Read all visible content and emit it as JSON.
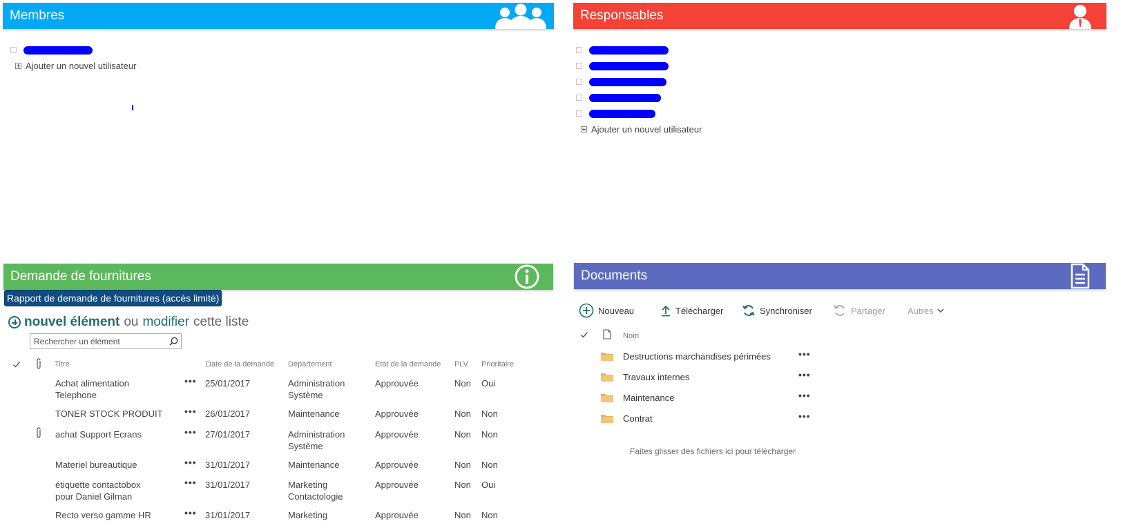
{
  "members": {
    "title": "Membres",
    "add_user_label": "Ajouter un nouvel utilisateur"
  },
  "responsables": {
    "title": "Responsables",
    "add_user_label": "Ajouter un nouvel utilisateur"
  },
  "fournitures": {
    "title": "Demande de fournitures",
    "report_link": "Rapport de demande de fournitures (accès limité)",
    "new_item": "nouvel élément",
    "or": "ou",
    "modify": "modifier",
    "this_list": "cette liste",
    "search_placeholder": "Rechercher un élément",
    "columns": {
      "title": "Titre",
      "date": "Date de la demande",
      "department": "Département",
      "state": "Etat de la demande",
      "plv": "PLV",
      "priority": "Prioritaire"
    },
    "rows": [
      {
        "title1": "Achat alimentation",
        "title2": "Telephone",
        "date": "25/01/2017",
        "dept1": "Administration",
        "dept2": "Système",
        "state": "Approuvée",
        "plv": "Non",
        "priority": "Oui"
      },
      {
        "title1": "TONER STOCK PRODUIT",
        "title2": "",
        "date": "26/01/2017",
        "dept1": "Maintenance",
        "dept2": "",
        "state": "Approuvée",
        "plv": "Non",
        "priority": "Non"
      },
      {
        "title1": "achat Support Ecrans",
        "title2": "",
        "date": "27/01/2017",
        "dept1": "Administration",
        "dept2": "Système",
        "state": "Approuvée",
        "plv": "Non",
        "priority": "Non"
      },
      {
        "title1": "Materiel bureautique",
        "title2": "",
        "date": "31/01/2017",
        "dept1": "Maintenance",
        "dept2": "",
        "state": "Approuvée",
        "plv": "Non",
        "priority": "Non"
      },
      {
        "title1": "étiquette contactobox",
        "title2": "pour Daniel Gilman",
        "date": "31/01/2017",
        "dept1": "Marketing",
        "dept2": "Contactologie",
        "state": "Approuvée",
        "plv": "Non",
        "priority": "Oui"
      },
      {
        "title1": "Recto verso gamme HR",
        "title2": "",
        "date": "31/01/2017",
        "dept1": "Marketing",
        "dept2": "",
        "state": "Approuvée",
        "plv": "Non",
        "priority": "Non"
      }
    ]
  },
  "documents": {
    "title": "Documents",
    "toolbar": {
      "new": "Nouveau",
      "upload": "Télécharger",
      "sync": "Synchroniser",
      "share": "Partager",
      "more": "Autres"
    },
    "column_name": "Nom",
    "folders": [
      "Destructions marchandises périmées",
      "Travaux internes",
      "Maintenance",
      "Contrat"
    ],
    "drop_hint": "Faites glisser des fichiers ici pour télécharger"
  },
  "colors": {
    "members": "#03a9f4",
    "responsables": "#f44336",
    "fournitures": "#5cb85c",
    "documents": "#5c6bc0",
    "redaction": "#0000ff"
  },
  "icons": [
    "group-icon",
    "person-icon",
    "info-icon",
    "document-icon",
    "search-icon",
    "paperclip-icon",
    "checkmark-icon",
    "folder-icon",
    "plus-circle-icon",
    "upload-icon",
    "sync-icon",
    "share-icon",
    "chevron-down-icon",
    "file-icon"
  ]
}
